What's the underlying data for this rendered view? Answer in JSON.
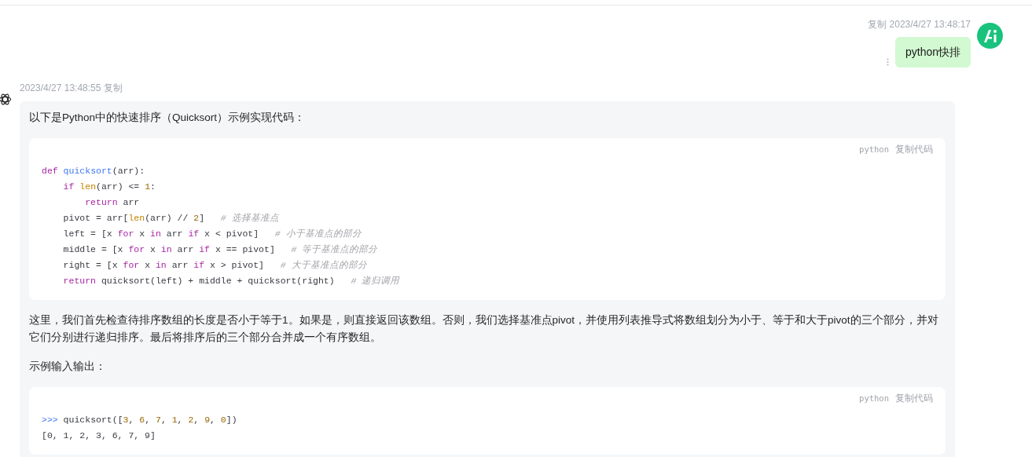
{
  "user_message": {
    "copy_label": "复制",
    "time": "2023/4/27 13:48:17",
    "text": "python快排"
  },
  "bot_message": {
    "time": "2023/4/27 13:48:55",
    "copy_label": "复制",
    "blocks": [
      {
        "kind": "paragraph",
        "text": "以下是Python中的快速排序（Quicksort）示例实现代码："
      },
      {
        "kind": "code",
        "language": "python",
        "copy_label": "复制代码",
        "lines": [
          [
            {
              "text": "def",
              "kind": "keyword"
            },
            {
              "text": " quicksort",
              "kind": "function"
            },
            {
              "text": "(arr):",
              "kind": "plain"
            }
          ],
          [
            {
              "text": "    if",
              "kind": "keyword"
            },
            {
              "text": " len",
              "kind": "builtin"
            },
            {
              "text": "(arr) <= ",
              "kind": "plain"
            },
            {
              "text": "1",
              "kind": "number"
            },
            {
              "text": ":",
              "kind": "plain"
            }
          ],
          [
            {
              "text": "        return",
              "kind": "keyword"
            },
            {
              "text": " arr",
              "kind": "plain"
            }
          ],
          [
            {
              "text": "    pivot = arr[",
              "kind": "plain"
            },
            {
              "text": "len",
              "kind": "builtin"
            },
            {
              "text": "(arr) // ",
              "kind": "plain"
            },
            {
              "text": "2",
              "kind": "number"
            },
            {
              "text": "]   ",
              "kind": "plain"
            },
            {
              "text": "# 选择基准点",
              "kind": "comment"
            }
          ],
          [
            {
              "text": "    left = [x ",
              "kind": "plain"
            },
            {
              "text": "for",
              "kind": "keyword"
            },
            {
              "text": " x ",
              "kind": "plain"
            },
            {
              "text": "in",
              "kind": "keyword"
            },
            {
              "text": " arr ",
              "kind": "plain"
            },
            {
              "text": "if",
              "kind": "keyword"
            },
            {
              "text": " x < pivot]   ",
              "kind": "plain"
            },
            {
              "text": "# 小于基准点的部分",
              "kind": "comment"
            }
          ],
          [
            {
              "text": "    middle = [x ",
              "kind": "plain"
            },
            {
              "text": "for",
              "kind": "keyword"
            },
            {
              "text": " x ",
              "kind": "plain"
            },
            {
              "text": "in",
              "kind": "keyword"
            },
            {
              "text": " arr ",
              "kind": "plain"
            },
            {
              "text": "if",
              "kind": "keyword"
            },
            {
              "text": " x == pivot]   ",
              "kind": "plain"
            },
            {
              "text": "# 等于基准点的部分",
              "kind": "comment"
            }
          ],
          [
            {
              "text": "    right = [x ",
              "kind": "plain"
            },
            {
              "text": "for",
              "kind": "keyword"
            },
            {
              "text": " x ",
              "kind": "plain"
            },
            {
              "text": "in",
              "kind": "keyword"
            },
            {
              "text": " arr ",
              "kind": "plain"
            },
            {
              "text": "if",
              "kind": "keyword"
            },
            {
              "text": " x > pivot]   ",
              "kind": "plain"
            },
            {
              "text": "# 大于基准点的部分",
              "kind": "comment"
            }
          ],
          [
            {
              "text": "    return",
              "kind": "keyword"
            },
            {
              "text": " quicksort(left) + middle + quicksort(right)   ",
              "kind": "plain"
            },
            {
              "text": "# 递归调用",
              "kind": "comment"
            }
          ]
        ]
      },
      {
        "kind": "paragraph",
        "text": "这里，我们首先检查待排序数组的长度是否小于等于1。如果是，则直接返回该数组。否则，我们选择基准点pivot，并使用列表推导式将数组划分为小于、等于和大于pivot的三个部分，并对它们分别进行递归排序。最后将排序后的三个部分合并成一个有序数组。"
      },
      {
        "kind": "paragraph",
        "text": "示例输入输出："
      },
      {
        "kind": "code",
        "language": "python",
        "copy_label": "复制代码",
        "lines": [
          [
            {
              "text": ">>>",
              "kind": "function"
            },
            {
              "text": " quicksort([",
              "kind": "plain"
            },
            {
              "text": "3",
              "kind": "number"
            },
            {
              "text": ", ",
              "kind": "plain"
            },
            {
              "text": "6",
              "kind": "number"
            },
            {
              "text": ", ",
              "kind": "plain"
            },
            {
              "text": "7",
              "kind": "number"
            },
            {
              "text": ", ",
              "kind": "plain"
            },
            {
              "text": "1",
              "kind": "number"
            },
            {
              "text": ", ",
              "kind": "plain"
            },
            {
              "text": "2",
              "kind": "number"
            },
            {
              "text": ", ",
              "kind": "plain"
            },
            {
              "text": "9",
              "kind": "number"
            },
            {
              "text": ", ",
              "kind": "plain"
            },
            {
              "text": "0",
              "kind": "number"
            },
            {
              "text": "])",
              "kind": "plain"
            }
          ],
          [
            {
              "text": "[0, 1, 2, 3, 6, 7, 9]",
              "kind": "plain"
            }
          ]
        ]
      }
    ]
  }
}
